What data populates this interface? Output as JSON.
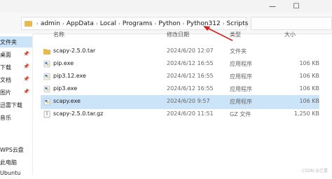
{
  "window": {
    "controls": {
      "minimize": "—",
      "maximize": "☐"
    }
  },
  "address_bar": {
    "crumbs": [
      "admin",
      "AppData",
      "Local",
      "Programs",
      "Python",
      "Python312",
      "Scripts"
    ],
    "separator": "›"
  },
  "sidebar": {
    "items": [
      {
        "label": "文件夹"
      },
      {
        "label": "桌面"
      },
      {
        "label": "下载"
      },
      {
        "label": "文档"
      },
      {
        "label": "图片"
      },
      {
        "label": "迅雷下载"
      },
      {
        "label": "音乐"
      },
      {
        "label": "WPS云盘"
      },
      {
        "label": "此电脑"
      },
      {
        "label": "Ubuntu"
      }
    ],
    "pin_icon": "pin-icon"
  },
  "columns": {
    "name": "名称",
    "date": "修改日期",
    "type": "类型",
    "size": "大小"
  },
  "files": [
    {
      "name": "scapy-2.5.0.tar",
      "date": "2024/6/20 12:07",
      "type": "文件夹",
      "size": "",
      "icon": "folder-icon"
    },
    {
      "name": "pip.exe",
      "date": "2024/6/12 16:55",
      "type": "应用程序",
      "size": "106 KB",
      "icon": "python-exe-icon"
    },
    {
      "name": "pip3.12.exe",
      "date": "2024/6/12 16:55",
      "type": "应用程序",
      "size": "106 KB",
      "icon": "python-exe-icon"
    },
    {
      "name": "pip3.exe",
      "date": "2024/6/12 16:55",
      "type": "应用程序",
      "size": "106 KB",
      "icon": "python-exe-icon"
    },
    {
      "name": "scapy.exe",
      "date": "2024/6/20 9:57",
      "type": "应用程序",
      "size": "106 KB",
      "icon": "python-exe-icon"
    },
    {
      "name": "scapy-2.5.0.tar.gz",
      "date": "2024/6/20 11:51",
      "type": "GZ 文件",
      "size": "1,250 KB",
      "icon": "archive-icon"
    }
  ],
  "selected_row": 4,
  "annotation": {
    "color": "#e02020"
  },
  "watermark": "CSDN @已重"
}
